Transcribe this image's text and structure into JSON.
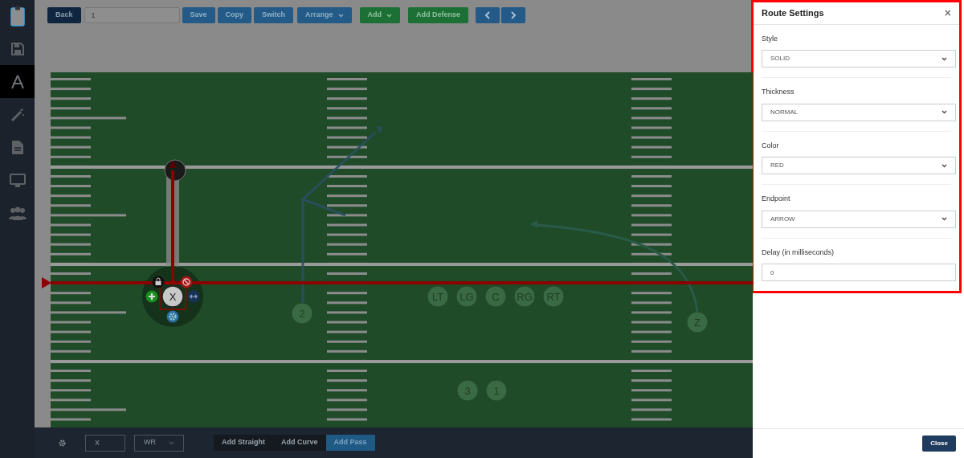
{
  "sidebar": {
    "items": [
      {
        "kind": "save",
        "selected": false
      },
      {
        "kind": "routes",
        "selected": true
      },
      {
        "kind": "magic",
        "selected": false
      },
      {
        "kind": "document",
        "selected": false
      },
      {
        "kind": "monitor",
        "selected": false
      },
      {
        "kind": "team",
        "selected": false
      }
    ]
  },
  "toolbar": {
    "back": "Back",
    "play_name": "1",
    "buttons": [
      {
        "label": "Save",
        "kind": "primary",
        "dropdown": false
      },
      {
        "label": "Copy",
        "kind": "primary",
        "dropdown": false
      },
      {
        "label": "Switch",
        "kind": "primary",
        "dropdown": false
      },
      {
        "label": "Arrange",
        "kind": "primary",
        "dropdown": true
      },
      {
        "label": "Add",
        "kind": "success",
        "dropdown": true
      },
      {
        "label": "Add Defense",
        "kind": "success",
        "dropdown": false
      }
    ],
    "nav": [
      {
        "kind": "prev"
      },
      {
        "kind": "next"
      }
    ]
  },
  "field": {
    "players": [
      {
        "label": "X",
        "selected": true
      },
      {
        "label": "2",
        "selected": false
      },
      {
        "label": "LT",
        "selected": false
      },
      {
        "label": "LG",
        "selected": false
      },
      {
        "label": "C",
        "selected": false
      },
      {
        "label": "RG",
        "selected": false
      },
      {
        "label": "RT",
        "selected": false
      },
      {
        "label": "Z",
        "selected": false
      },
      {
        "label": "3",
        "selected": false
      },
      {
        "label": "1",
        "selected": false
      }
    ]
  },
  "bottom_bar": {
    "label_value": "X",
    "position_value": "WR",
    "route_buttons": [
      {
        "label": "Add Straight",
        "selected": false
      },
      {
        "label": "Add Curve",
        "selected": false
      },
      {
        "label": "Add Pass",
        "selected": true
      }
    ]
  },
  "panel": {
    "title": "Route Settings",
    "close_icon": "×",
    "fields": [
      {
        "label": "Style",
        "kind": "select",
        "value": "SOLID"
      },
      {
        "label": "Thickness",
        "kind": "select",
        "value": "NORMAL"
      },
      {
        "label": "Color",
        "kind": "select",
        "value": "RED"
      },
      {
        "label": "Endpoint",
        "kind": "select",
        "value": "ARROW"
      },
      {
        "label": "Delay (in milliseconds)",
        "kind": "input",
        "value": "0"
      }
    ],
    "close_button": "Close"
  }
}
